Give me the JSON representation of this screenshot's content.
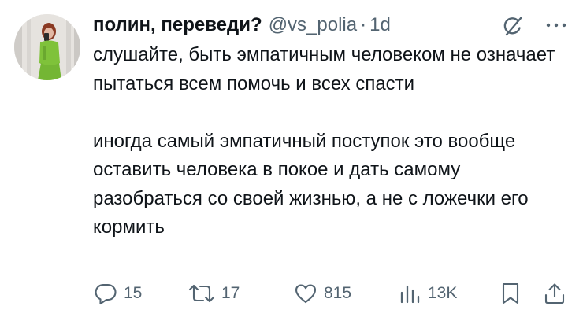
{
  "tweet": {
    "display_name": "полин, переведи?",
    "handle": "@vs_polia",
    "separator": "·",
    "time": "1d",
    "paragraphs": [
      "слушайте, быть эмпатичным человеком не означает пытаться всем помочь и всех спасти",
      "иногда самый эмпатичный поступок это вообще оставить человека в покое и дать самому разобраться со своей жизнью, а не с ложечки его кормить"
    ]
  },
  "actions": {
    "replies": "15",
    "reposts": "17",
    "likes": "815",
    "views": "13K"
  },
  "icons": {
    "header": [
      "grok-icon",
      "more-icon"
    ],
    "actions": [
      "reply-icon",
      "repost-icon",
      "like-icon",
      "views-icon",
      "bookmark-icon",
      "share-icon"
    ]
  },
  "colors": {
    "text": "#0f1419",
    "secondary": "#536471",
    "background": "#ffffff"
  }
}
